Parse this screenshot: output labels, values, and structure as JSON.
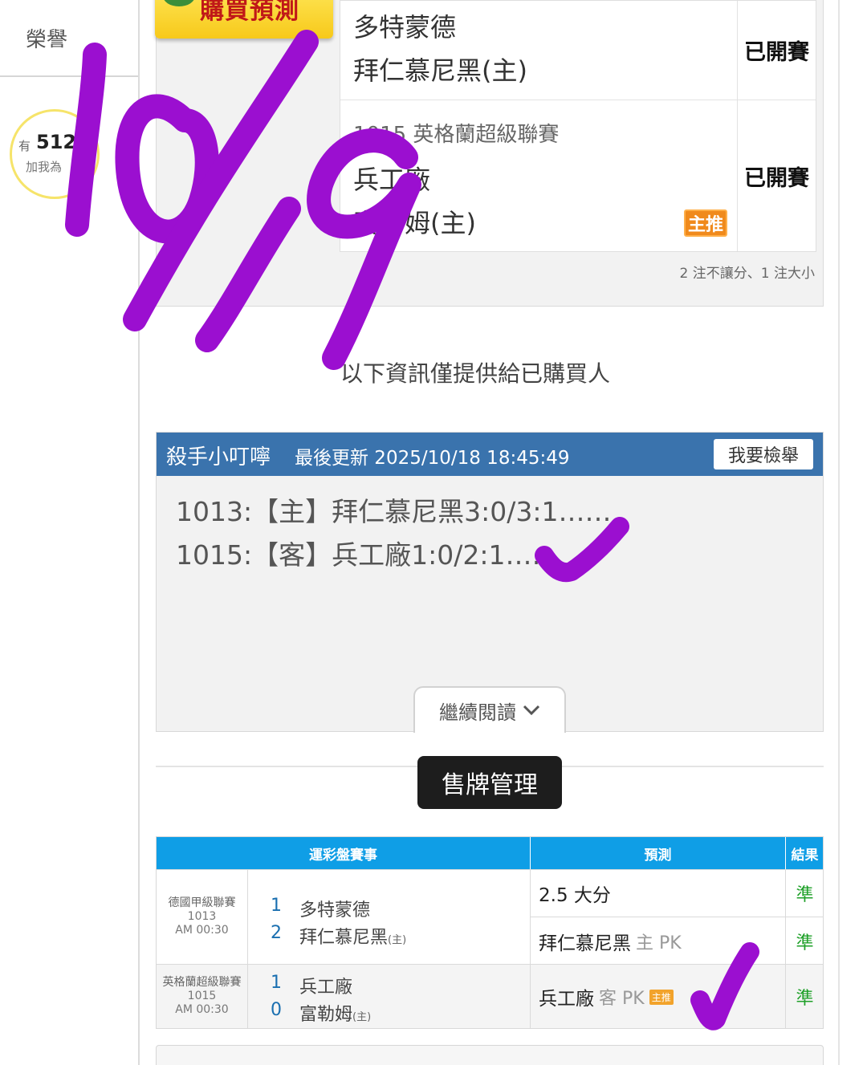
{
  "sidebar": {
    "tab_label": "榮譽",
    "fan_prefix": "有",
    "fan_count": "512",
    "fan_sub": "加我為"
  },
  "banner": {
    "label": "購買預測"
  },
  "matches": [
    {
      "league": "",
      "away": "多特蒙德",
      "home": "拜仁慕尼黑(主)",
      "status": "已開賽"
    },
    {
      "league": "1015 英格蘭超級聯賽",
      "away": "兵工廠",
      "home": "富勒姆(主)",
      "status": "已開賽",
      "badge": "主推"
    }
  ],
  "pick_summary": "2 注不讓分、1 注大小",
  "buyer_note": "以下資訊僅提供給已購買人",
  "article": {
    "author": "殺手小叮嚀",
    "updated": "最後更新 2025/10/18 18:45:49",
    "report_label": "我要檢舉",
    "lines": [
      "1013:【主】拜仁慕尼黑3:0/3:1……",
      "1015:【客】兵工廠1:0/2:1……"
    ],
    "read_more": "繼續閱讀"
  },
  "sale_button": "售牌管理",
  "record": {
    "headers": {
      "event": "運彩盤賽事",
      "prediction": "預測",
      "result": "結果"
    },
    "rows": [
      {
        "league": "德國甲級聯賽",
        "code": "1013",
        "time": "AM 00:30",
        "teams": [
          {
            "score": "1",
            "name": "多特蒙德",
            "tag": ""
          },
          {
            "score": "2",
            "name": "拜仁慕尼黑",
            "tag": "(主)"
          }
        ],
        "predictions": [
          {
            "text": "2.5 大分",
            "side": "",
            "hot": "",
            "result": "準"
          },
          {
            "text": "拜仁慕尼黑",
            "side": "主 PK",
            "hot": "",
            "result": "準"
          }
        ]
      },
      {
        "league": "英格蘭超級聯賽",
        "code": "1015",
        "time": "AM 00:30",
        "teams": [
          {
            "score": "1",
            "name": "兵工廠",
            "tag": ""
          },
          {
            "score": "0",
            "name": "富勒姆",
            "tag": "(主)"
          }
        ],
        "predictions": [
          {
            "text": "兵工廠",
            "side": "客 PK",
            "hot": "主推",
            "result": "準"
          }
        ]
      }
    ]
  },
  "handwriting": {
    "date": "10/9",
    "color": "#9b0fd0"
  }
}
